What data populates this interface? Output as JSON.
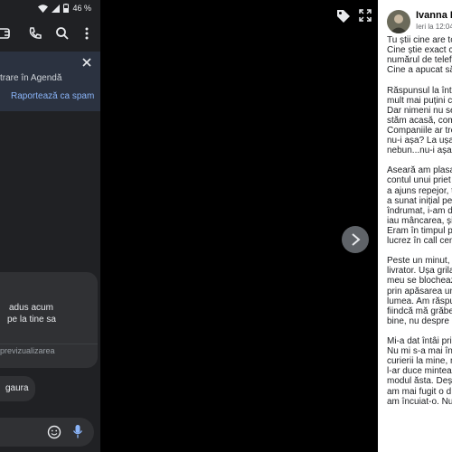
{
  "status_bar": {
    "battery": "46 %"
  },
  "banner": {
    "text": "trare în Agendă",
    "spam_link": "Raportează ca spam"
  },
  "messages": [
    {
      "lines": [
        "adus acum",
        "pe la tine sa"
      ]
    },
    {
      "lines": [
        "gaura"
      ]
    }
  ],
  "link_preview": {
    "text": "previzualizarea"
  },
  "post": {
    "author": "Ivanna Ra",
    "date": "Ieri la 12:04",
    "lines": [
      "Tu știi cine are to",
      "Cine știe exact cu",
      "numărul de telef",
      "Cine a apucat să",
      "",
      "Răspunsul la într",
      "mult mai puțini c",
      "Dar nimeni nu se",
      "stăm acasă, coma",
      "Companiile ar tre",
      "nu-i așa? La ușa",
      "nebun...nu-i așa?",
      "",
      "Aseară am plasat",
      "contul unui priet",
      "a ajuns repejor, t",
      "a sunat inițial pe",
      "îndrumat, i-am d",
      "iau mâncarea, și",
      "Eram în timpul p",
      "lucrez în call cen",
      "",
      "Peste un minut, a",
      "livrator. Ușa grila",
      "meu se blocheaz",
      "prin apăsarea un",
      "lumea. Am răspu",
      "fiindcă mă grăbe",
      "bine, nu despre a",
      "",
      "Mi-a dat întâi pri",
      "Nu mi s-a mai în",
      "curierii la mine, n",
      "l-ar duce mintea",
      "modul ăsta. Deși",
      "am mai fugit o d",
      "am încuiat-o. Nu"
    ]
  },
  "colors": {
    "link": "#8ab4f8",
    "phone_bg": "#202124",
    "bubble": "#303134"
  },
  "icons": [
    "wifi-icon",
    "signal-icon",
    "battery-icon",
    "video-call-icon",
    "phone-icon",
    "search-icon",
    "more-vert-icon",
    "close-icon",
    "emoji-icon",
    "mic-icon",
    "tag-icon",
    "fullscreen-icon",
    "chevron-right-icon"
  ]
}
